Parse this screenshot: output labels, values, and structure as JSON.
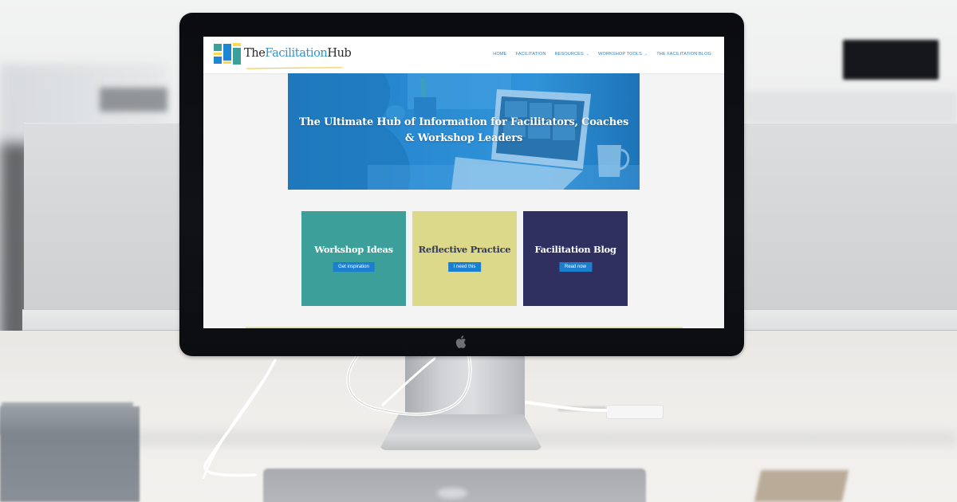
{
  "site": {
    "logo": {
      "prefix": "The",
      "accent": "Facilitation",
      "suffix": "Hub",
      "icon": "logo-blocks-icon"
    },
    "nav": [
      {
        "label": "HOME",
        "has_dropdown": false
      },
      {
        "label": "FACILITATION",
        "has_dropdown": false
      },
      {
        "label": "RESOURCES",
        "has_dropdown": true
      },
      {
        "label": "WORKSHOP TOOLS",
        "has_dropdown": true
      },
      {
        "label": "THE FACILITATION BLOG",
        "has_dropdown": false
      }
    ],
    "caret_glyph": "⌄",
    "hero": {
      "title": "The Ultimate Hub of Information for Facilitators, Coaches & Workshop Leaders",
      "image": "woman-on-video-call-laptop-photo"
    },
    "cards": [
      {
        "title": "Workshop Ideas",
        "button": "Get inspiration",
        "color": "#3c9f9a"
      },
      {
        "title": "Reflective Practice",
        "button": "I need this",
        "color": "#dcd98b"
      },
      {
        "title": "Facilitation Blog",
        "button": "Read now",
        "color": "#2f3060"
      }
    ]
  },
  "colors": {
    "brand_blue": "#2c94d6",
    "nav_text": "#2c7fc0",
    "button_blue": "#1a7fd1",
    "logo_teal": "#3c9f9a",
    "logo_yellow": "#f7d955",
    "monitor_bezel": "#0c0d10"
  },
  "scene": {
    "device": "desktop-monitor",
    "brand_icon": "apple-logo-icon"
  }
}
